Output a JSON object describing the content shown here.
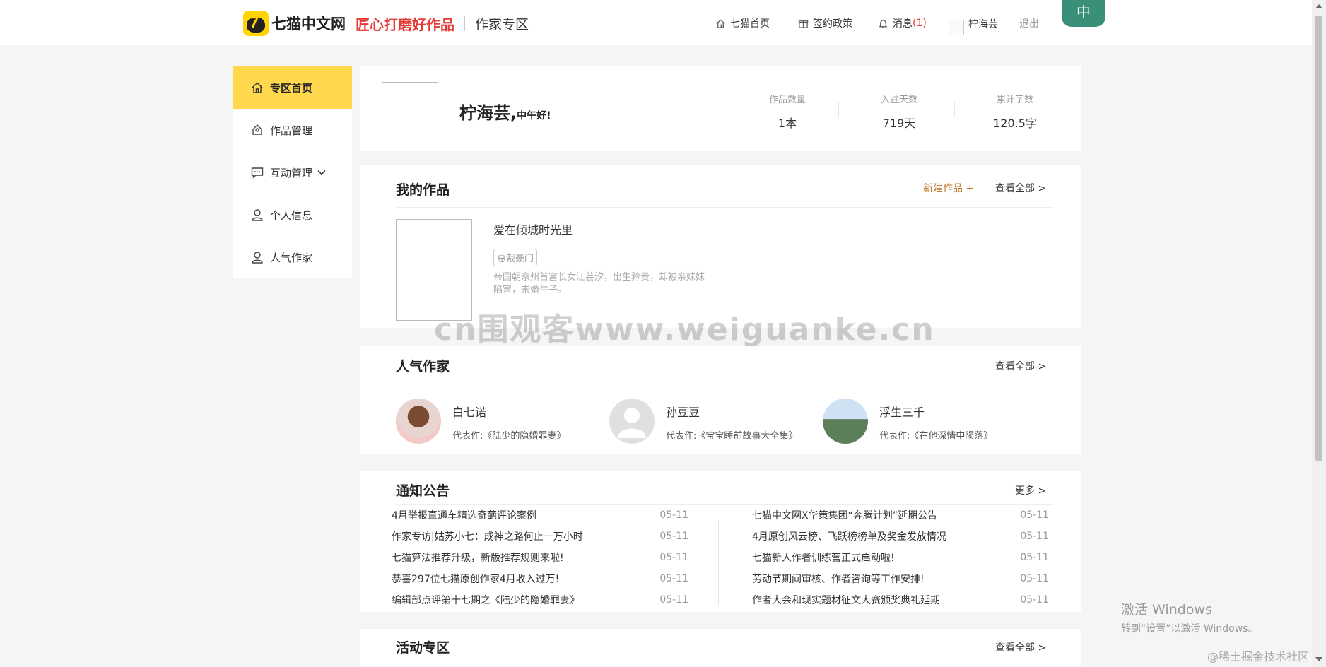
{
  "header": {
    "logo_text": "七猫中文网",
    "slogan": "匠心打磨好作品",
    "zone": "作家专区",
    "nav": {
      "home": "七猫首页",
      "policy": "签约政策",
      "messages": "消息",
      "message_count": "(1)",
      "username": "柠海芸",
      "logout": "退出"
    },
    "corner_badge": "中"
  },
  "sidebar": {
    "items": [
      {
        "label": "专区首页",
        "icon": "home-icon"
      },
      {
        "label": "作品管理",
        "icon": "edit-icon"
      },
      {
        "label": "互动管理",
        "icon": "chat-icon"
      },
      {
        "label": "个人信息",
        "icon": "user-icon"
      },
      {
        "label": "人气作家",
        "icon": "user-icon"
      }
    ]
  },
  "profile": {
    "name": "柠海芸,",
    "greeting": "中午好!",
    "stats": [
      {
        "label": "作品数量",
        "value": "1本"
      },
      {
        "label": "入驻天数",
        "value": "719天"
      },
      {
        "label": "累计字数",
        "value": "120.5字"
      }
    ]
  },
  "works": {
    "title": "我的作品",
    "new_link": "新建作品 +",
    "all_link": "查看全部 >",
    "book": {
      "title": "爱在倾城时光里",
      "tag": "总裁豪门",
      "desc": "帝国朝京州首富长女江芸汐，出生矜贵，却被亲妹妹陷害，未婚生子。"
    }
  },
  "authors": {
    "title": "人气作家",
    "all_link": "查看全部 >",
    "list": [
      {
        "name": "白七诺",
        "work": "代表作:《陆少的隐婚罪妻》"
      },
      {
        "name": "孙豆豆",
        "work": "代表作:《宝宝睡前故事大全集》"
      },
      {
        "name": "浮生三千",
        "work": "代表作:《在他深情中陨落》"
      }
    ]
  },
  "notices": {
    "title": "通知公告",
    "more_link": "更多 >",
    "left": [
      {
        "text": "4月举报直通车精选奇葩评论案例",
        "date": "05-11"
      },
      {
        "text": "作家专访|姑苏小七：成神之路何止一万小时",
        "date": "05-11"
      },
      {
        "text": "七猫算法推荐升级，新版推荐规则来啦!",
        "date": "05-11"
      },
      {
        "text": "恭喜297位七猫原创作家4月收入过万!",
        "date": "05-11"
      },
      {
        "text": "编辑部点评第十七期之《陆少的隐婚罪妻》",
        "date": "05-11"
      }
    ],
    "right": [
      {
        "text": "七猫中文网X华策集团“奔腾计划”延期公告",
        "date": "05-11"
      },
      {
        "text": "4月原创风云榜、飞跃榜榜单及奖金发放情况",
        "date": "05-11"
      },
      {
        "text": "七猫新人作者训练营正式启动啦!",
        "date": "05-11"
      },
      {
        "text": "劳动节期间审核、作者咨询等工作安排!",
        "date": "05-11"
      },
      {
        "text": "作者大会和现实题材征文大赛颁奖典礼延期",
        "date": "05-11"
      }
    ]
  },
  "activity": {
    "title": "活动专区",
    "all_link": "查看全部 >"
  },
  "overlays": {
    "watermark": "cn围观客www.weiguanke.cn",
    "windows_activate_title": "激活 Windows",
    "windows_activate_sub": "转到“设置”以激活 Windows。",
    "juejin": "@稀土掘金技术社区"
  },
  "colors": {
    "accent_yellow": "#ffd84e",
    "slogan_red": "#e53935",
    "new_work_orange": "#c0762a"
  }
}
